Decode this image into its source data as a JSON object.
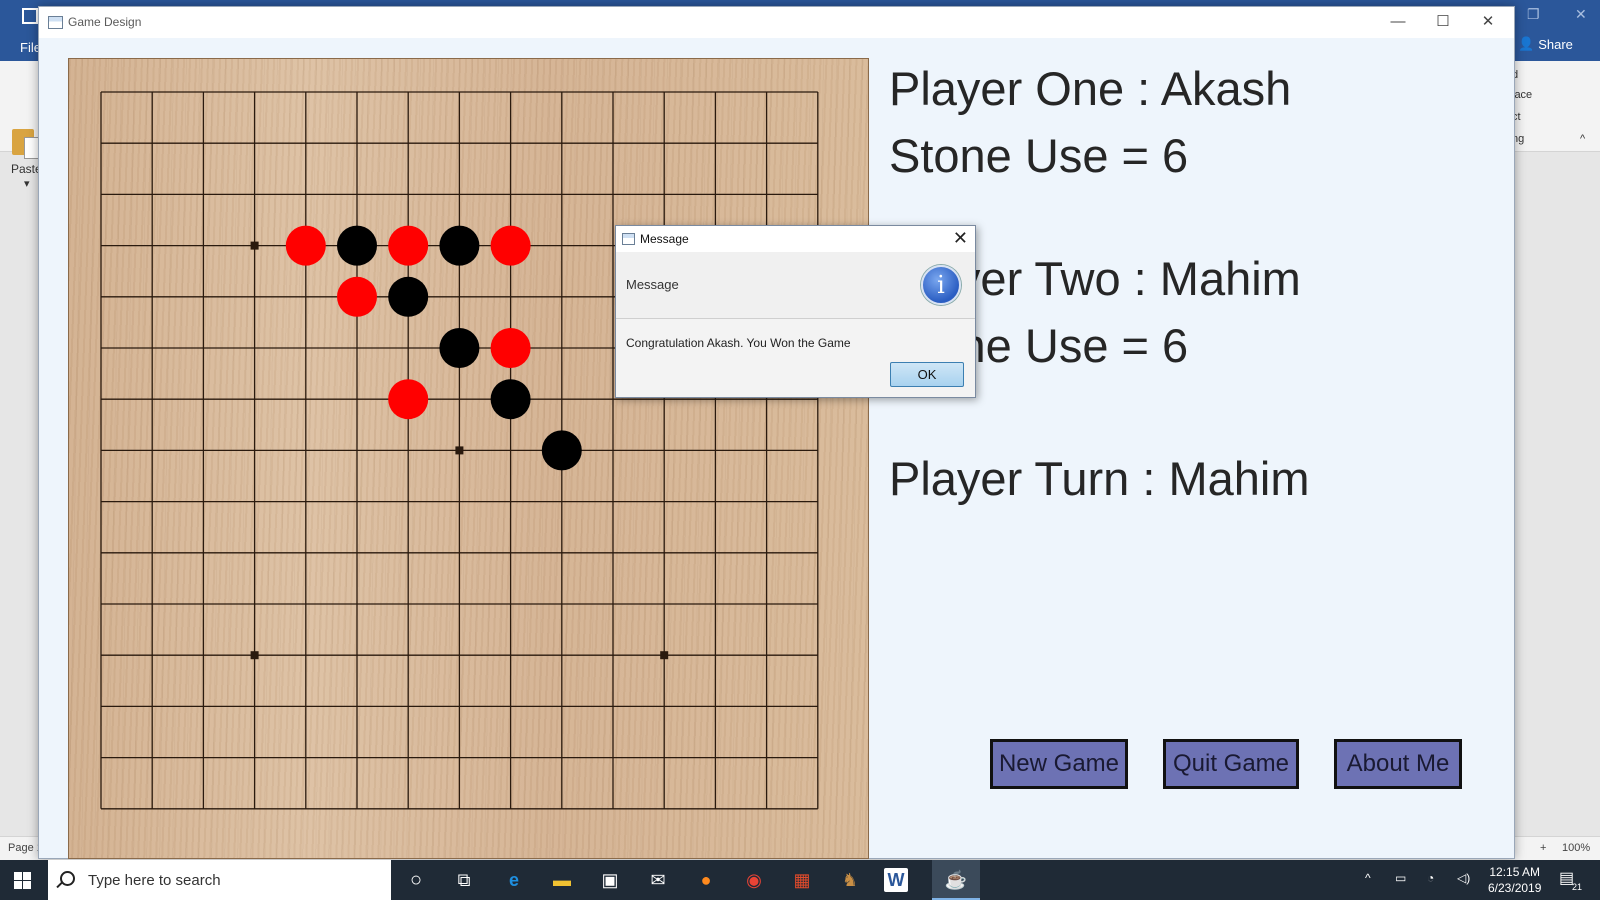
{
  "word": {
    "file_label": "File",
    "share_label": "Share",
    "paste_label": "Paste",
    "ribbon_fragments": [
      "d",
      "lace",
      "ct",
      "ng"
    ],
    "status_page": "Page 1",
    "zoom": "100%"
  },
  "app": {
    "title": "Game Design",
    "minimize": "—",
    "maximize": "☐",
    "close": "✕"
  },
  "board": {
    "size": 15,
    "star_points": [
      [
        3,
        3
      ],
      [
        7,
        7
      ],
      [
        3,
        11
      ],
      [
        11,
        11
      ]
    ],
    "stones": [
      {
        "col": 4,
        "row": 3,
        "color": "red"
      },
      {
        "col": 5,
        "row": 3,
        "color": "black"
      },
      {
        "col": 6,
        "row": 3,
        "color": "red"
      },
      {
        "col": 7,
        "row": 3,
        "color": "black"
      },
      {
        "col": 8,
        "row": 3,
        "color": "red"
      },
      {
        "col": 5,
        "row": 4,
        "color": "red"
      },
      {
        "col": 6,
        "row": 4,
        "color": "black"
      },
      {
        "col": 7,
        "row": 5,
        "color": "black"
      },
      {
        "col": 8,
        "row": 5,
        "color": "red"
      },
      {
        "col": 6,
        "row": 6,
        "color": "red"
      },
      {
        "col": 8,
        "row": 6,
        "color": "black"
      },
      {
        "col": 9,
        "row": 7,
        "color": "black"
      }
    ],
    "colors": {
      "red": "#ff0000",
      "black": "#000000",
      "line": "#2a1a0e"
    }
  },
  "info": {
    "player_one": "Player One : Akash",
    "stone_use_one": "Stone Use = 6",
    "player_two": "Player Two : Mahim",
    "stone_use_two": "Stone Use = 6",
    "player_turn": "Player Turn : Mahim"
  },
  "buttons": {
    "new_game": "New Game",
    "quit_game": "Quit Game",
    "about_me": "About Me"
  },
  "dialog": {
    "title": "Message",
    "header": "Message",
    "message": "Congratulation Akash. You Won the Game",
    "ok": "OK",
    "close": "✕",
    "info_glyph": "i"
  },
  "taskbar": {
    "search_placeholder": "Type here to search",
    "time": "12:15 AM",
    "date": "6/23/2019",
    "notifications": "21"
  }
}
